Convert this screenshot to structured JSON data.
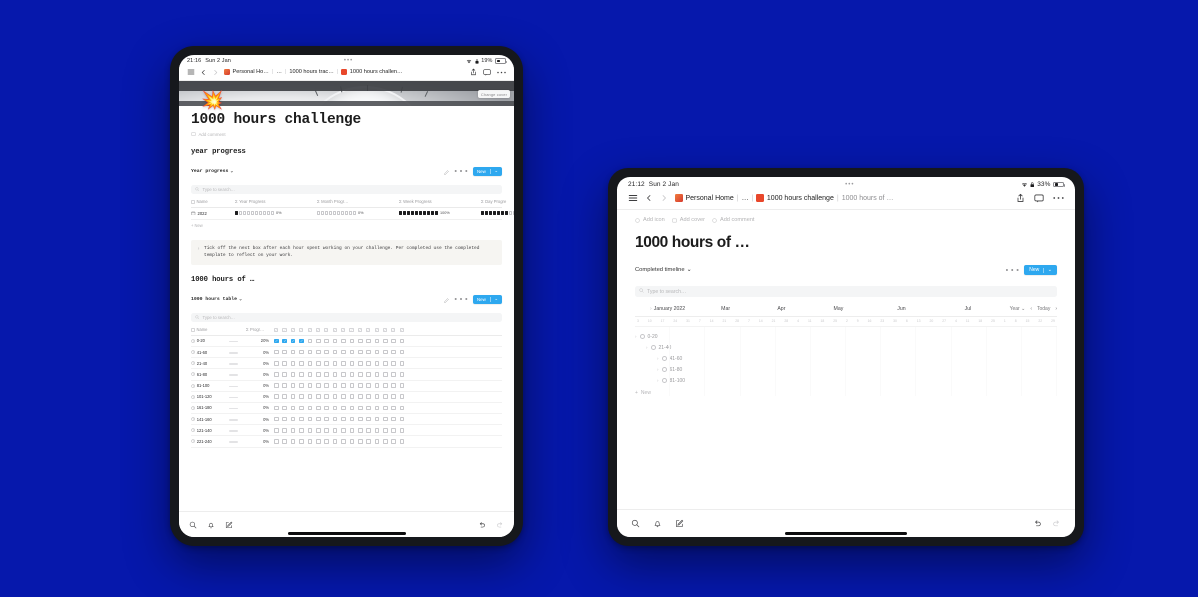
{
  "background_color": "#0618ac",
  "accent_color": "#2ea8ef",
  "tablet_left": {
    "statusbar": {
      "time": "21:16",
      "date": "Sun 2 Jan",
      "battery": "19%",
      "grabber": "•••"
    },
    "nav": {
      "menu_icon": "hamburger-icon",
      "back_icon": "arrow-left-icon",
      "forward_icon": "arrow-right-icon",
      "breadcrumbs": [
        {
          "label": "Personal Ho…",
          "icon": "home-emoji-icon"
        },
        {
          "label": "…",
          "icon": ""
        },
        {
          "label": "1000 hours trac…",
          "icon": ""
        },
        {
          "label": "1000 hours challen…",
          "icon": "page-red-icon"
        }
      ],
      "share_icon": "share-icon",
      "comment_icon": "comment-icon",
      "more_icon": "ellipsis-icon"
    },
    "cover": {
      "change_cover_label": "Change cover",
      "emoji": "💥"
    },
    "page": {
      "title": "1000 hours challenge",
      "add_comment_label": "Add comment"
    },
    "section_year": {
      "heading": "year progress",
      "view_name": "Year progress",
      "search_placeholder": "Type to search…",
      "new_button": "New",
      "table": {
        "columns": [
          "Name",
          "Year Progress",
          "Month Progr…",
          "Week Progress",
          "Day Progre"
        ],
        "rows": [
          {
            "name": "2022",
            "year_progress": {
              "filled": 1,
              "total": 10,
              "pct": "0%"
            },
            "month_progress": {
              "filled": 0,
              "total": 10,
              "pct": "0%"
            },
            "week_progress": {
              "filled": 10,
              "total": 10,
              "pct": "100%"
            },
            "day_progress": {
              "filled": 7,
              "total": 10,
              "pct": ""
            }
          }
        ],
        "more_label": "New"
      }
    },
    "callout": {
      "text": "Tick off the next box after each hour spent working on your challenge. Per completed use the completed template to reflect on your work."
    },
    "section_hours": {
      "heading": "1000 hours of …",
      "view_name": "1000 hours table",
      "search_placeholder": "Type to search…",
      "new_button": "New",
      "columns": {
        "name": "Name",
        "progress": "Progr…"
      },
      "rows": [
        {
          "name": "0-20",
          "pct": "20%",
          "checked": [
            true,
            true,
            true,
            true,
            false,
            false,
            false,
            false,
            false,
            false,
            false,
            false,
            false,
            false,
            false,
            false
          ]
        },
        {
          "name": "41-60",
          "pct": "0%",
          "checked": [
            false,
            false,
            false,
            false,
            false,
            false,
            false,
            false,
            false,
            false,
            false,
            false,
            false,
            false,
            false,
            false
          ]
        },
        {
          "name": "21-40",
          "pct": "0%",
          "checked": [
            false,
            false,
            false,
            false,
            false,
            false,
            false,
            false,
            false,
            false,
            false,
            false,
            false,
            false,
            false,
            false
          ]
        },
        {
          "name": "61-80",
          "pct": "0%",
          "checked": [
            false,
            false,
            false,
            false,
            false,
            false,
            false,
            false,
            false,
            false,
            false,
            false,
            false,
            false,
            false,
            false
          ]
        },
        {
          "name": "81-100",
          "pct": "0%",
          "checked": [
            false,
            false,
            false,
            false,
            false,
            false,
            false,
            false,
            false,
            false,
            false,
            false,
            false,
            false,
            false,
            false
          ]
        },
        {
          "name": "101-120",
          "pct": "0%",
          "checked": [
            false,
            false,
            false,
            false,
            false,
            false,
            false,
            false,
            false,
            false,
            false,
            false,
            false,
            false,
            false,
            false
          ]
        },
        {
          "name": "161-180",
          "pct": "0%",
          "checked": [
            false,
            false,
            false,
            false,
            false,
            false,
            false,
            false,
            false,
            false,
            false,
            false,
            false,
            false,
            false,
            false
          ]
        },
        {
          "name": "141-160",
          "pct": "0%",
          "checked": [
            false,
            false,
            false,
            false,
            false,
            false,
            false,
            false,
            false,
            false,
            false,
            false,
            false,
            false,
            false,
            false
          ]
        },
        {
          "name": "121-140",
          "pct": "0%",
          "checked": [
            false,
            false,
            false,
            false,
            false,
            false,
            false,
            false,
            false,
            false,
            false,
            false,
            false,
            false,
            false,
            false
          ]
        },
        {
          "name": "221-240",
          "pct": "0%",
          "checked": [
            false,
            false,
            false,
            false,
            false,
            false,
            false,
            false,
            false,
            false,
            false,
            false,
            false,
            false,
            false,
            false
          ]
        }
      ]
    },
    "bottombar": {
      "search_icon": "search-icon",
      "notifications_icon": "bell-icon",
      "new_page_icon": "compose-icon",
      "undo_icon": "undo-icon",
      "redo_icon": "redo-icon"
    }
  },
  "tablet_right": {
    "statusbar": {
      "time": "21:12",
      "date": "Sun 2 Jan",
      "battery": "33%",
      "grabber": "•••"
    },
    "nav": {
      "menu_icon": "hamburger-icon",
      "back_icon": "arrow-left-icon",
      "forward_icon": "arrow-right-icon",
      "breadcrumbs": [
        {
          "label": "Personal Home",
          "icon": "home-emoji-icon"
        },
        {
          "label": "…",
          "icon": ""
        },
        {
          "label": "1000 hours challenge",
          "icon": "page-red-icon"
        },
        {
          "label": "1000 hours of …",
          "icon": ""
        }
      ],
      "share_icon": "share-icon",
      "comment_icon": "comment-icon",
      "more_icon": "ellipsis-icon"
    },
    "page": {
      "add_icon_label": "Add icon",
      "add_cover_label": "Add cover",
      "add_comment_label": "Add comment",
      "title": "1000 hours of …"
    },
    "view": {
      "view_name": "Completed timeline",
      "search_placeholder": "Type to search…",
      "new_button": "New"
    },
    "timeline": {
      "months": [
        "January 2022",
        "Mar",
        "Apr",
        "May",
        "Jun",
        "Jul"
      ],
      "zoom_label": "Year",
      "today_label": "Today",
      "prev_icon": "chevron-left-icon",
      "next_icon": "chevron-right-icon",
      "day_ticks": [
        "3",
        "10",
        "17",
        "24",
        "31",
        "7",
        "14",
        "21",
        "28",
        "7",
        "14",
        "21",
        "28",
        "4",
        "11",
        "18",
        "25",
        "2",
        "9",
        "16",
        "23",
        "30",
        "6",
        "13",
        "20",
        "27",
        "4",
        "11",
        "18",
        "25",
        "1",
        "8",
        "15",
        "22",
        "29"
      ],
      "items": [
        {
          "label": "0-20",
          "indent": 0
        },
        {
          "label": "21-40",
          "indent": 1
        },
        {
          "label": "41-60",
          "indent": 2
        },
        {
          "label": "61-80",
          "indent": 2
        },
        {
          "label": "81-100",
          "indent": 2
        }
      ],
      "new_label": "New"
    },
    "bottombar": {
      "search_icon": "search-icon",
      "notifications_icon": "bell-icon",
      "new_page_icon": "compose-icon",
      "undo_icon": "undo-icon",
      "redo_icon": "redo-icon"
    }
  }
}
